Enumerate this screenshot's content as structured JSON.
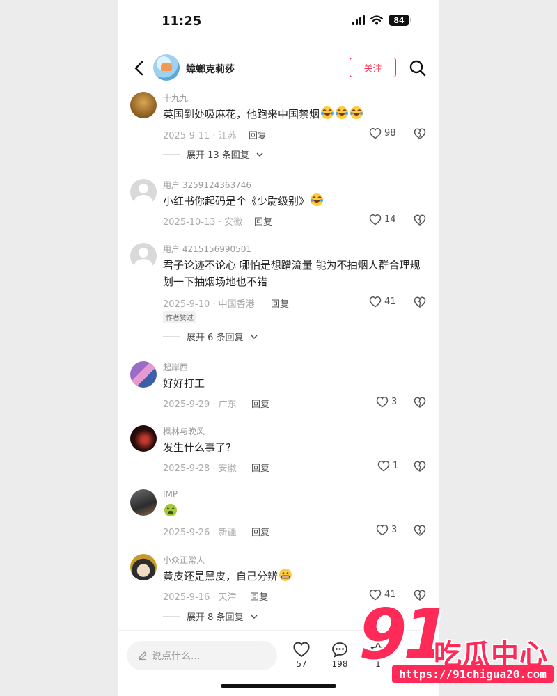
{
  "status_bar": {
    "time": "11:25",
    "battery": "84"
  },
  "header": {
    "username": "蟑螂克莉莎",
    "follow_label": "关注"
  },
  "comments": [
    {
      "user": "十九九",
      "text": "英国到处吸麻花，他跑来中国禁烟",
      "emoji": [
        "laughing-crying",
        "laughing-crying",
        "laughing-crying"
      ],
      "meta": "2025-9-11 · 江苏",
      "reply": "回复",
      "likes": "98",
      "expand": "展开 13 条回复"
    },
    {
      "user": "用户 3259124363746",
      "text": "小红书你起码是个《少尉级别》",
      "emoji": [
        "laughing-crying"
      ],
      "meta": "2025-10-13 · 安徽",
      "reply": "回复",
      "likes": "14"
    },
    {
      "user": "用户 4215156990501",
      "text": "君子论迹不论心 哪怕是想蹭流量 能为不抽烟人群合理规划一下抽烟场地也不错",
      "meta": "2025-9-10 · 中国香港",
      "reply": "回复",
      "likes": "41",
      "badge": "作者赞过",
      "expand": "展开 6 条回复"
    },
    {
      "user": "起岸西",
      "text": "好好打工",
      "meta": "2025-9-29 · 广东",
      "reply": "回复",
      "likes": "3"
    },
    {
      "user": "枫林与晚风",
      "text": "发生什么事了?",
      "meta": "2025-9-28 · 安徽",
      "reply": "回复",
      "likes": "1"
    },
    {
      "user": "IMP",
      "text": "",
      "emoji": [
        "nauseated"
      ],
      "meta": "2025-9-26 · 新疆",
      "reply": "回复",
      "likes": "3"
    },
    {
      "user": "小众正常人",
      "text": "黄皮还是黑皮，自己分辨",
      "emoji": [
        "grimacing"
      ],
      "meta": "2025-9-16 · 天津",
      "reply": "回复",
      "likes": "41",
      "expand": "展开 8 条回复"
    }
  ],
  "bottom_bar": {
    "input_placeholder": "说点什么...",
    "likes": "57",
    "comments": "198",
    "collects": "1"
  },
  "watermark": {
    "logo_text": "91",
    "title": "吃瓜中心",
    "url": "https://91chigua20.com"
  },
  "colors": {
    "accent": "#ff2e4d",
    "watermark": "#ff2a57"
  }
}
